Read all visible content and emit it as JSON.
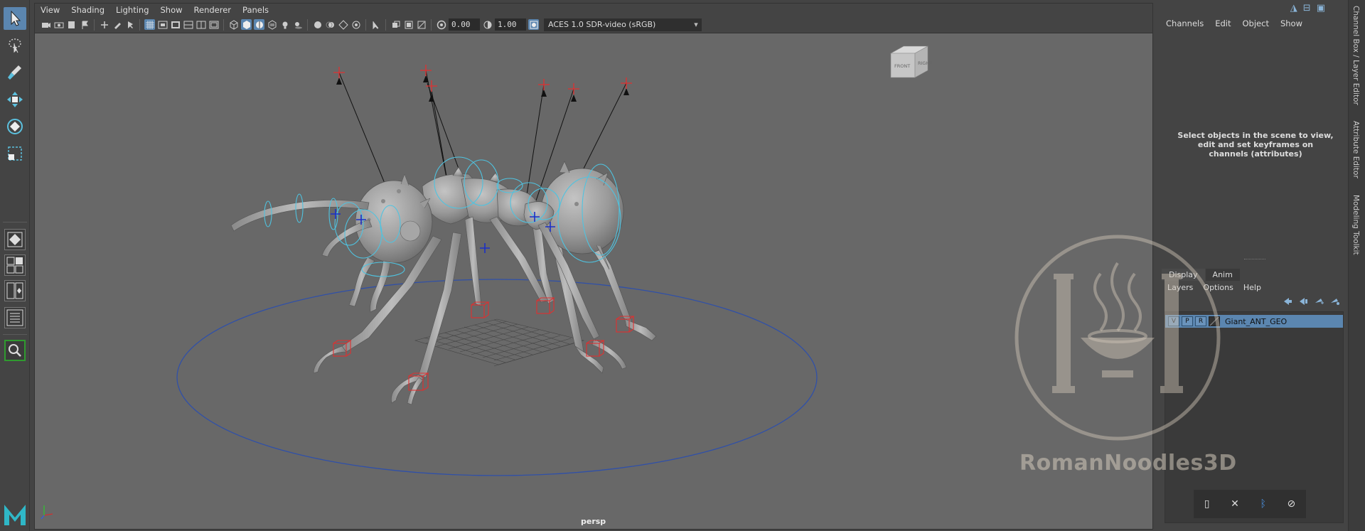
{
  "viewport": {
    "menu": [
      "View",
      "Shading",
      "Lighting",
      "Show",
      "Renderer",
      "Panels"
    ],
    "field_a": "0.00",
    "field_b": "1.00",
    "color_space": "ACES 1.0 SDR-video (sRGB)",
    "camera_label": "persp",
    "viewcube_front": "FRONT",
    "viewcube_right": "RIGHT"
  },
  "right_panel": {
    "menu": [
      "Channels",
      "Edit",
      "Object",
      "Show"
    ],
    "channel_hint": "Select objects in the scene to view, edit and set keyframes on channels (attributes)",
    "layer_tabs": [
      "Display",
      "Anim"
    ],
    "layer_menu": [
      "Layers",
      "Options",
      "Help"
    ],
    "layer": {
      "v": "V",
      "p": "P",
      "r": "R",
      "name": "Giant_ANT_GEO"
    }
  },
  "side_tabs": [
    "Channel Box / Layer Editor",
    "Attribute Editor",
    "Modeling Toolkit"
  ],
  "watermark": "RomanNoodles3D",
  "colors": {
    "accent": "#5b86b0",
    "viewport_bg": "#686868",
    "panel_bg": "#444444",
    "controller": "#4fc3e0",
    "ik_handle": "#e03030"
  },
  "logo": "M"
}
